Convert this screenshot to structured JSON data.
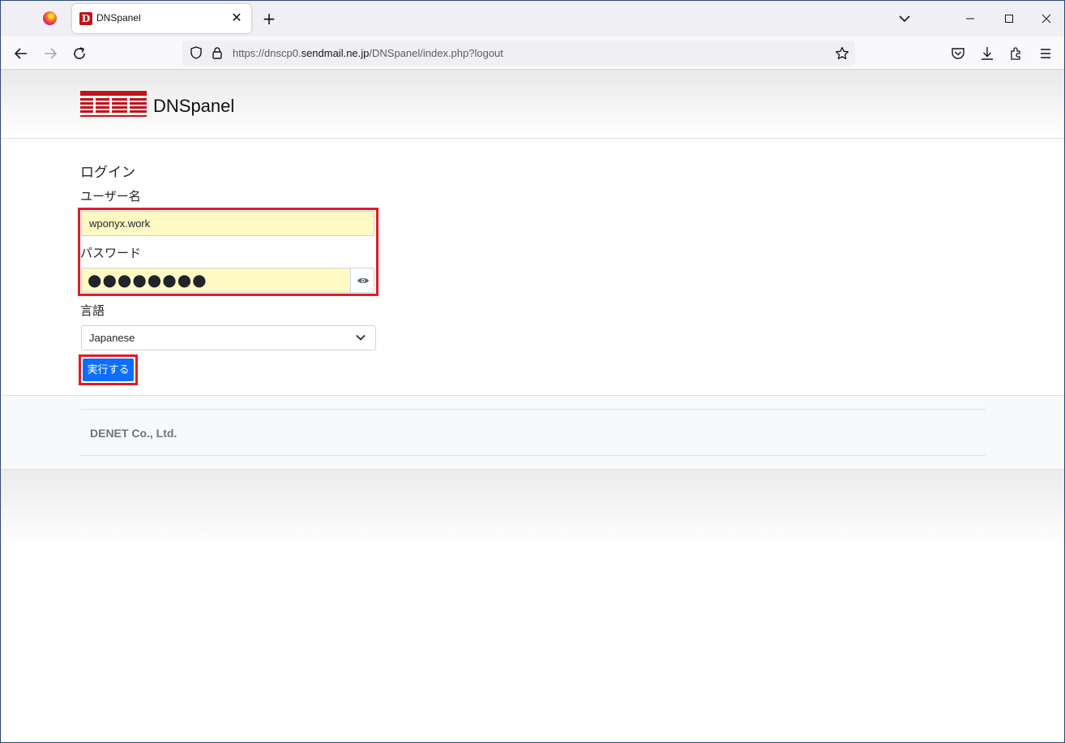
{
  "browser": {
    "tab_title": "DNSpanel",
    "tab_favicon_letter": "D",
    "url_prefix": "https://dnscp0.",
    "url_domain": "sendmail.ne.jp",
    "url_path": "/DNSpanel/index.php?logout"
  },
  "header": {
    "title": "DNSpanel"
  },
  "login": {
    "heading": "ログイン",
    "username_label": "ユーザー名",
    "username_value": "wponyx.work",
    "password_label": "パスワード",
    "password_value": "●●●●●●●●",
    "language_label": "言語",
    "language_selected": "Japanese",
    "submit_label": "実行する"
  },
  "footer": {
    "company": "DENET Co., Ltd."
  },
  "colors": {
    "highlight": "#e01c24",
    "primary_button": "#0d6efd",
    "autofill": "#fff9c4",
    "brand_red": "#c0141c"
  }
}
